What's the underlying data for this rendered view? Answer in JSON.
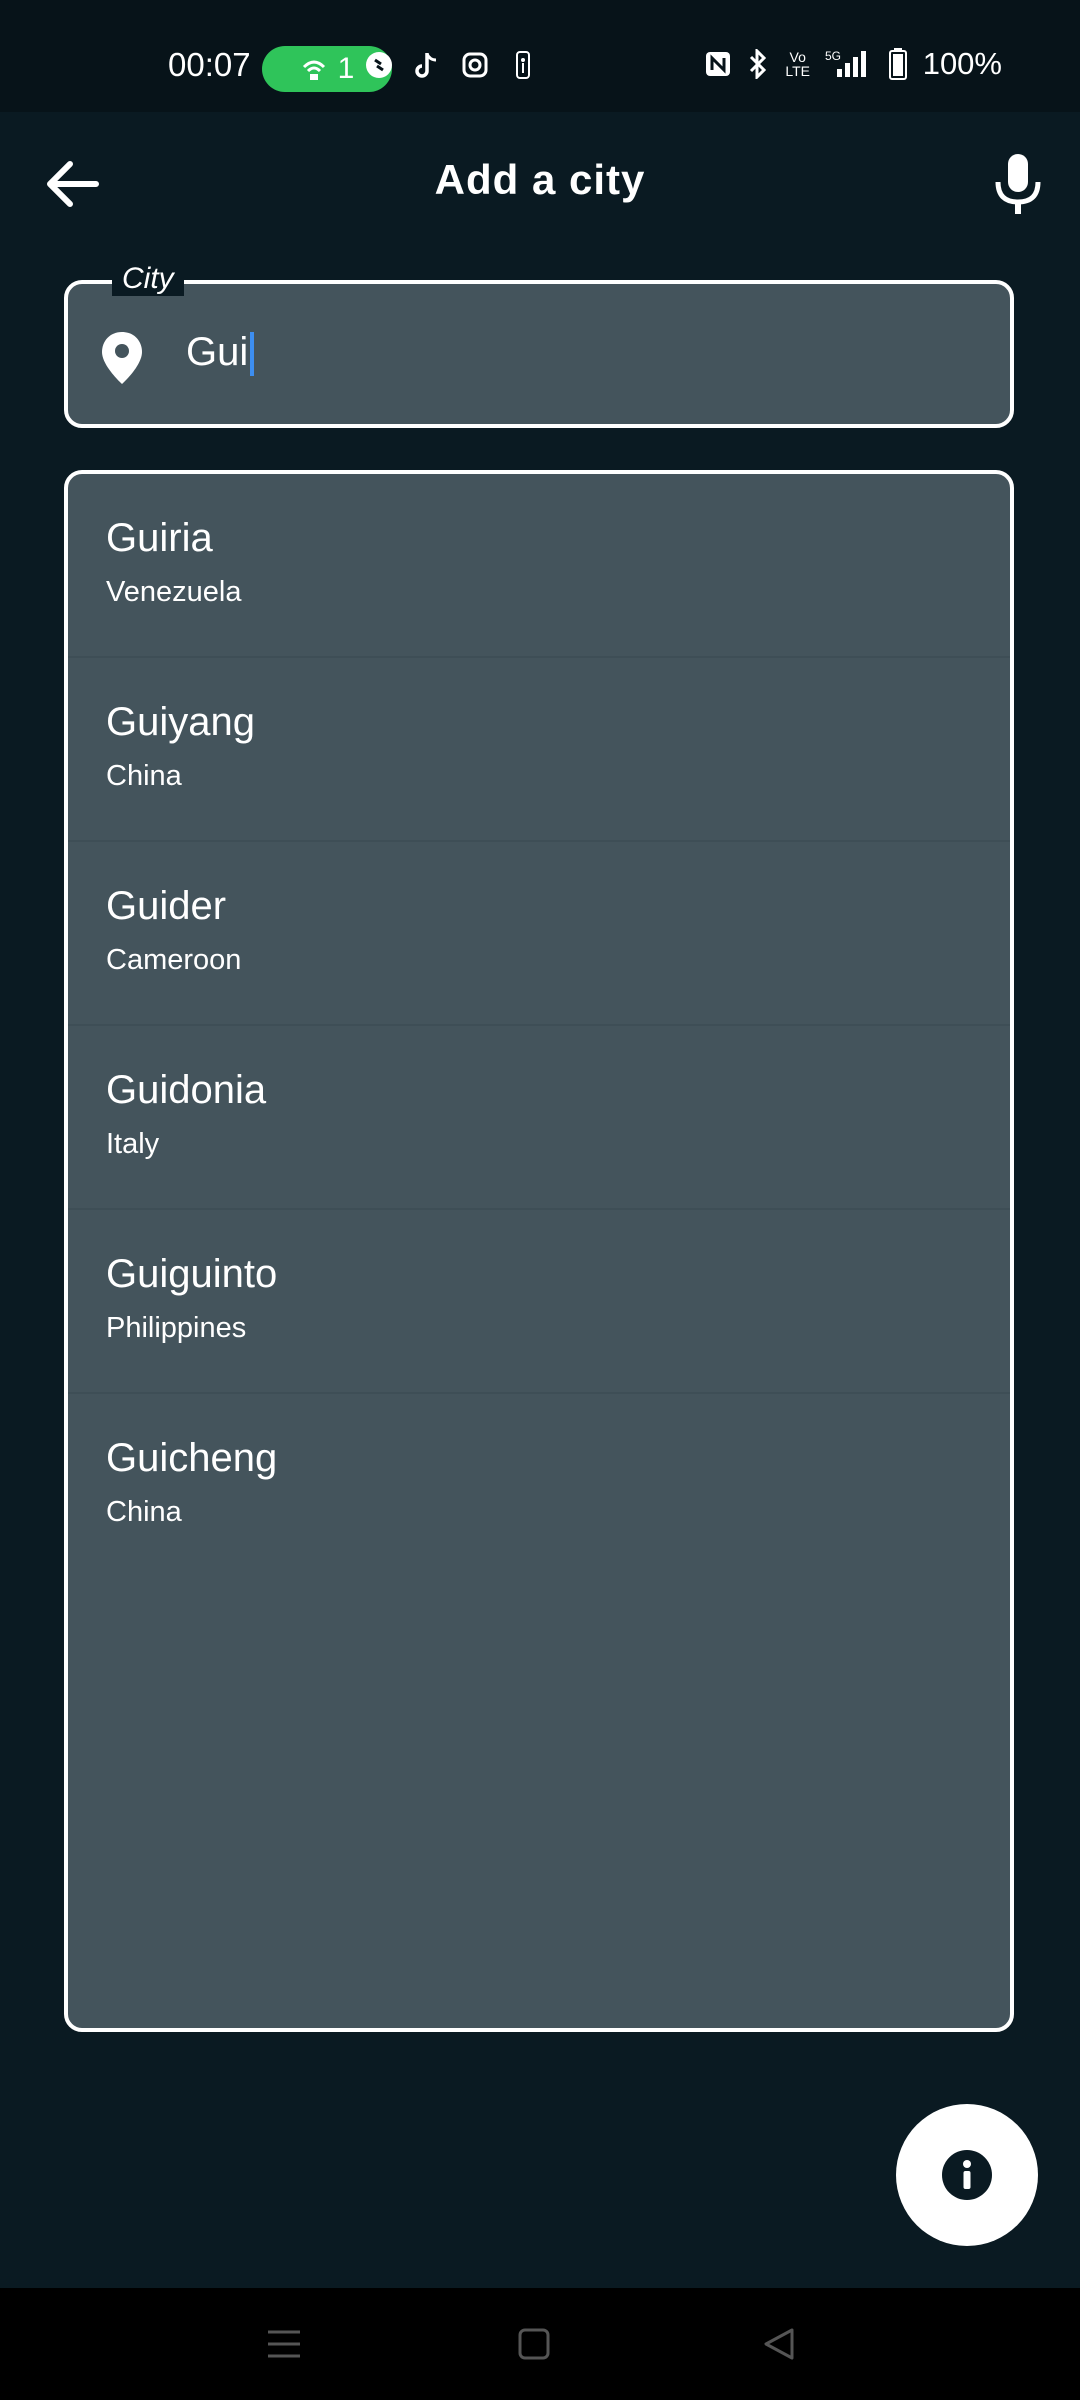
{
  "status_bar": {
    "time": "00:07",
    "hotspot_count": "1",
    "battery": "100%",
    "icons_left": [
      "shazam-icon",
      "tiktok-icon",
      "instagram-icon",
      "nba-icon"
    ],
    "icons_right": [
      "nfc-icon",
      "bluetooth-icon",
      "volte-icon",
      "5g-signal-icon",
      "battery-icon"
    ]
  },
  "header": {
    "title": "Add a city"
  },
  "city_input": {
    "label": "City",
    "value": "Gui"
  },
  "results": [
    {
      "city": "Guiria",
      "country": "Venezuela"
    },
    {
      "city": "Guiyang",
      "country": "China"
    },
    {
      "city": "Guider",
      "country": "Cameroon"
    },
    {
      "city": "Guidonia",
      "country": "Italy"
    },
    {
      "city": "Guiguinto",
      "country": "Philippines"
    },
    {
      "city": "Guicheng",
      "country": "China"
    }
  ],
  "colors": {
    "background": "#0a1a22",
    "panel": "#44545c",
    "accent_caret": "#3d8ef0",
    "hotspot_green": "#2fc45a"
  }
}
